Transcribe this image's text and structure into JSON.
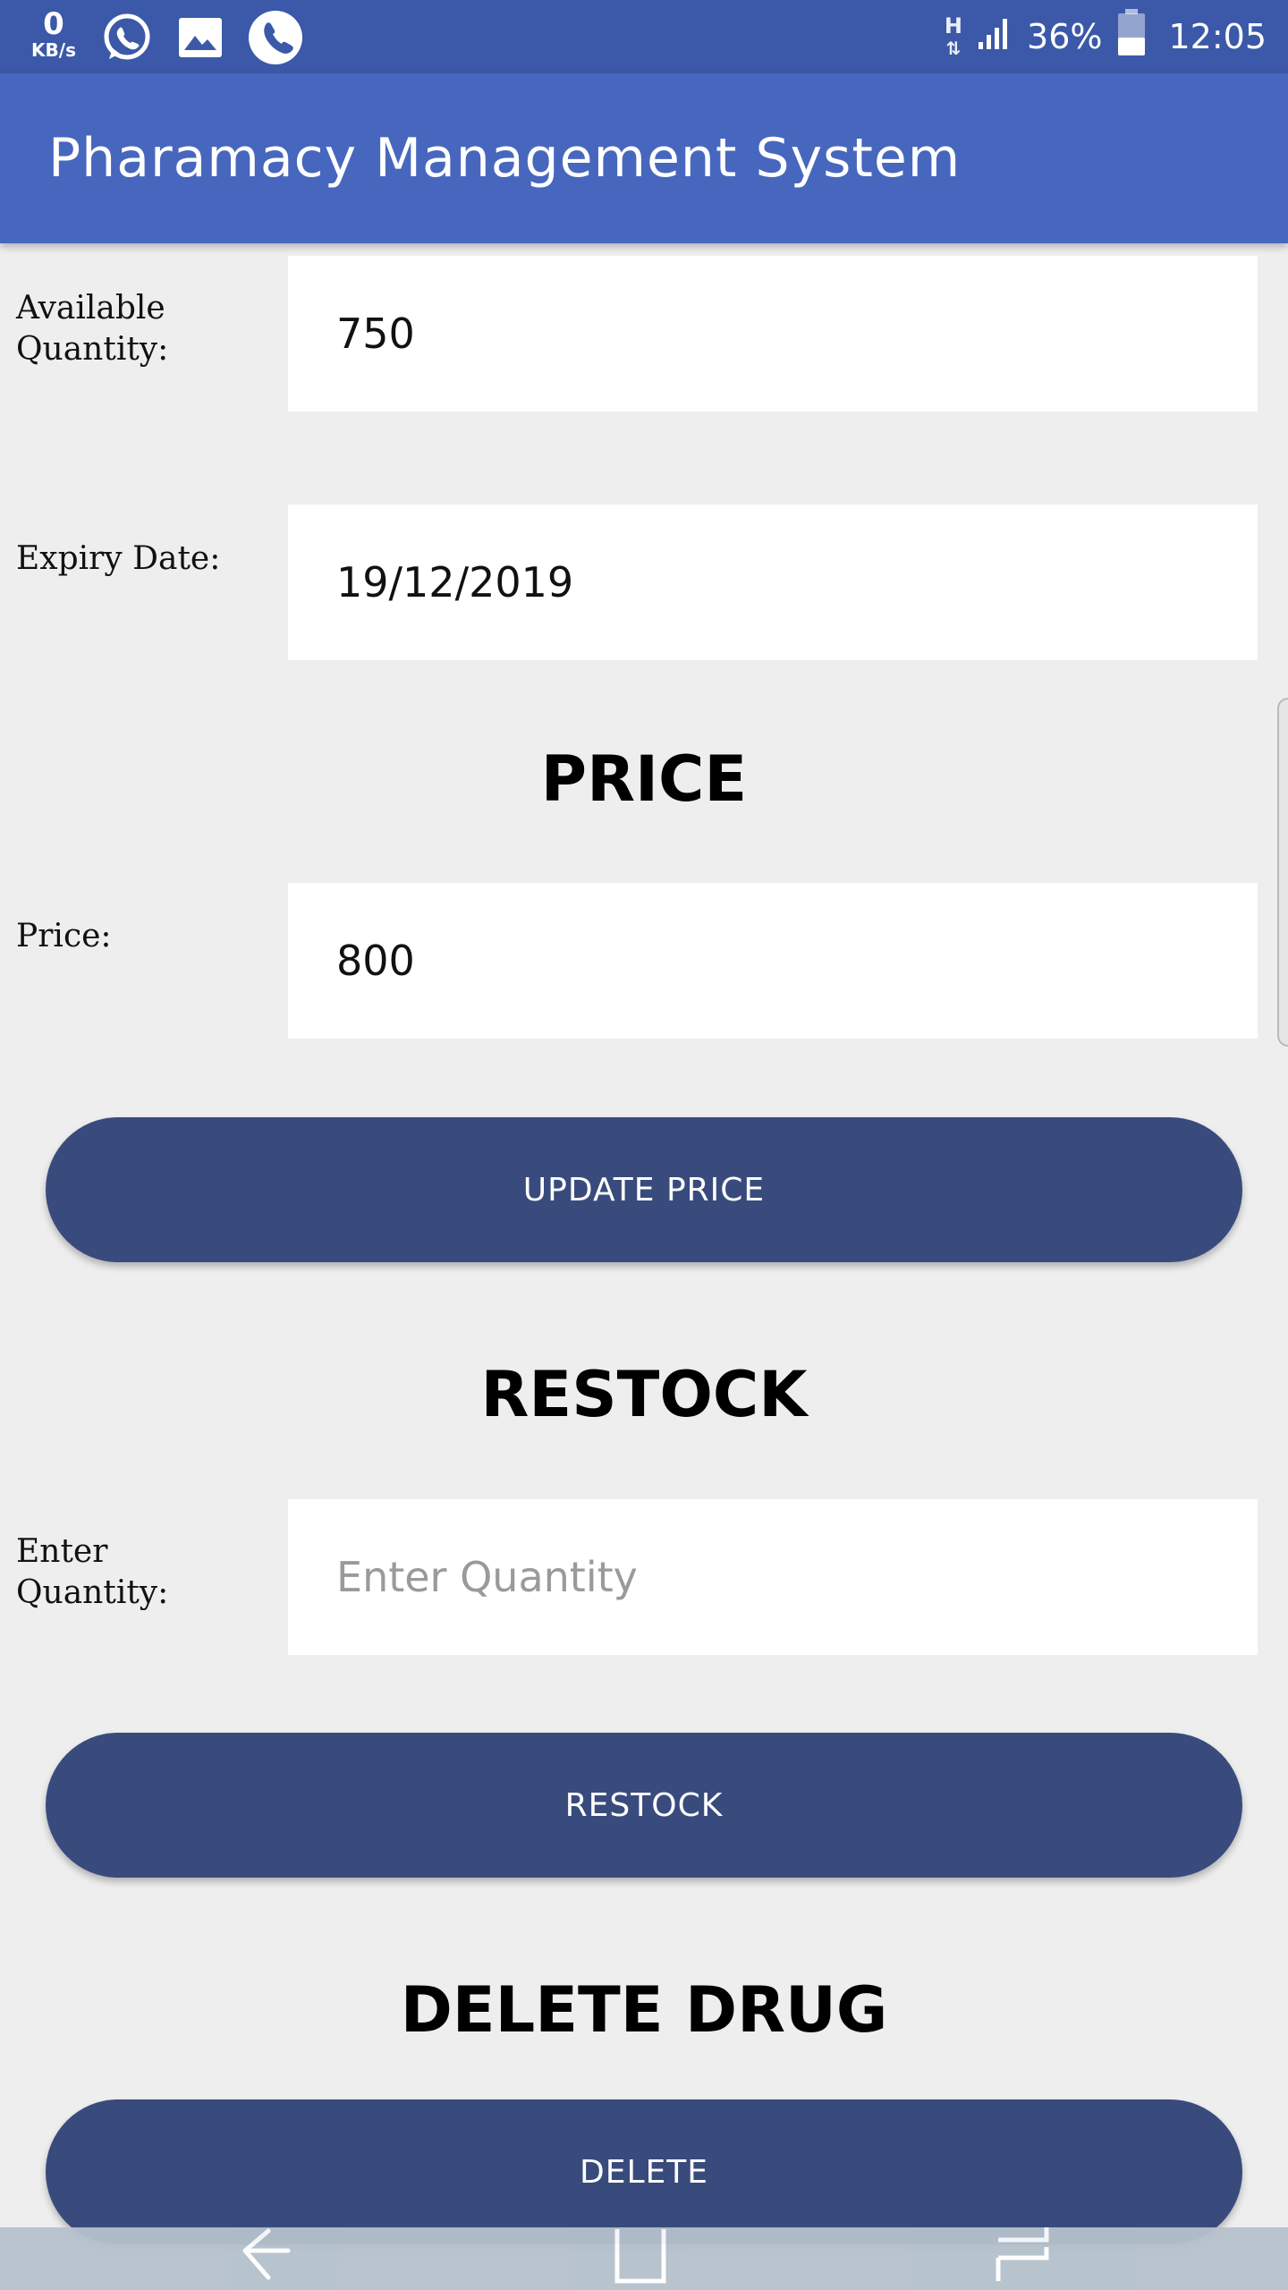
{
  "status_bar": {
    "speed_value": "0",
    "speed_unit": "KB/s",
    "network_type": "H",
    "battery": "36%",
    "time": "12:05"
  },
  "app_bar": {
    "title": "Pharamacy Management System"
  },
  "form": {
    "available_quantity": {
      "label": "Available Quantity:",
      "value": "750"
    },
    "expiry_date": {
      "label": "Expiry Date:",
      "value": "19/12/2019"
    }
  },
  "price_section": {
    "title": "PRICE",
    "price": {
      "label": "Price:",
      "value": "800"
    },
    "button_label": "UPDATE PRICE"
  },
  "restock_section": {
    "title": "RESTOCK",
    "quantity": {
      "label": "Enter Quantity:",
      "placeholder": "Enter Quantity",
      "value": ""
    },
    "button_label": "RESTOCK"
  },
  "delete_section": {
    "title": "DELETE DRUG",
    "button_label": "DELETE"
  },
  "colors": {
    "status_bar": "#3b59a8",
    "app_bar": "#4767be",
    "button": "#394b7d",
    "background": "#eeeeee"
  }
}
